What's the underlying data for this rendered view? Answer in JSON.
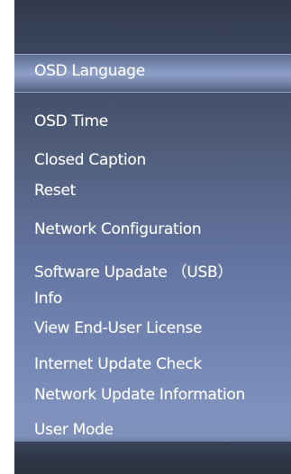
{
  "menu": {
    "items": [
      {
        "label": "OSD Language",
        "selected": true
      },
      {
        "label": "OSD Time",
        "selected": false
      },
      {
        "label": "Closed Caption",
        "selected": false
      },
      {
        "label": "Reset",
        "selected": false
      },
      {
        "label": "Network Configuration",
        "selected": false
      },
      {
        "label": "Software Upadate （USB）",
        "selected": false
      },
      {
        "label": "Info",
        "selected": false
      },
      {
        "label": "View End-User License",
        "selected": false
      },
      {
        "label": "Internet Update Check",
        "selected": false
      },
      {
        "label": "Network Update Information",
        "selected": false
      },
      {
        "label": "User Mode",
        "selected": false
      }
    ]
  },
  "colors": {
    "text": "#ffffff",
    "highlight": "#8fa0c8",
    "background_top": "#323a4a",
    "background_bottom": "#8092bd"
  }
}
